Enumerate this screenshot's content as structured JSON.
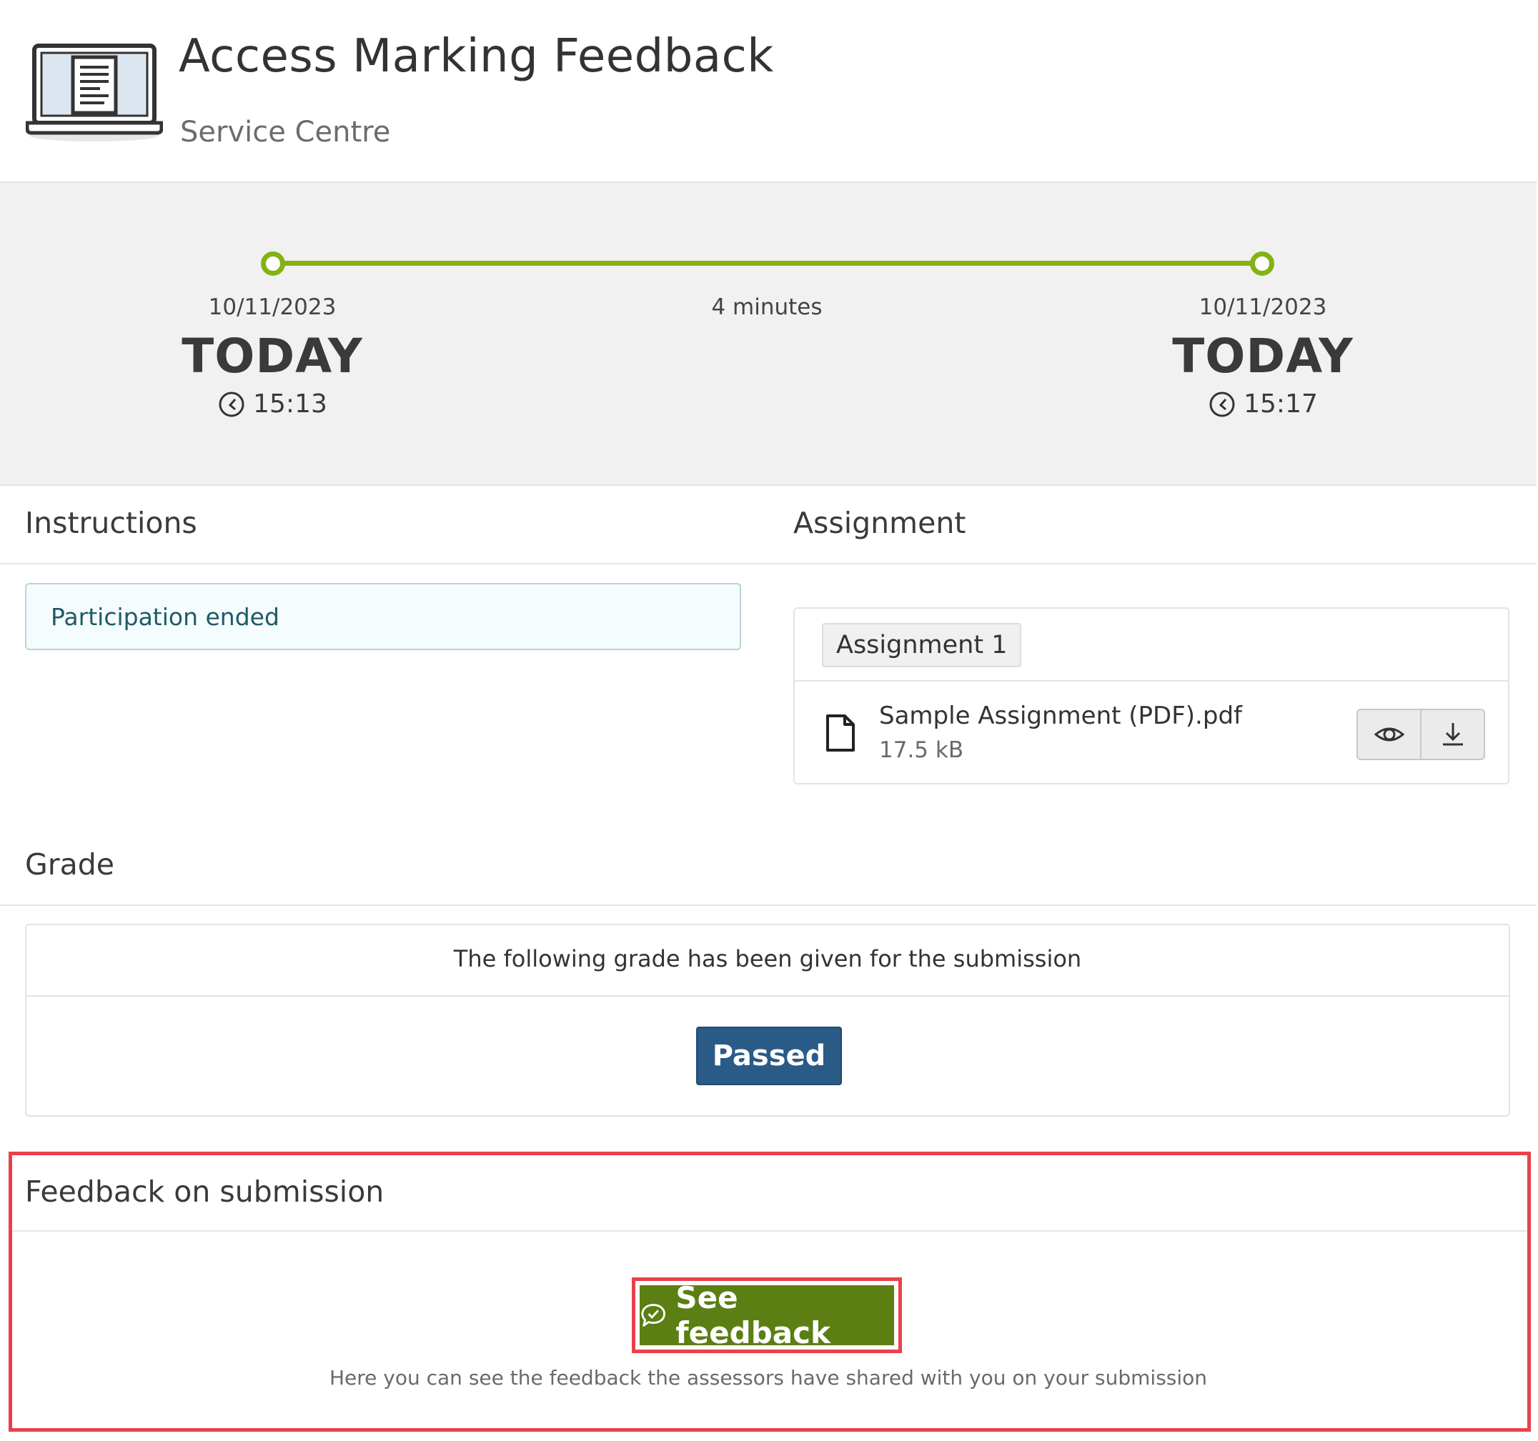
{
  "header": {
    "title": "Access Marking Feedback",
    "subtitle": "Service Centre",
    "icon": "laptop-document-icon"
  },
  "timeline": {
    "start": {
      "date": "10/11/2023",
      "day": "TODAY",
      "time": "15:13"
    },
    "end": {
      "date": "10/11/2023",
      "day": "TODAY",
      "time": "15:17"
    },
    "duration": "4 minutes",
    "accent_color": "#84b214",
    "progress": 1.0
  },
  "instructions": {
    "heading": "Instructions",
    "notice": "Participation ended"
  },
  "assignment": {
    "heading": "Assignment",
    "tab_label": "Assignment 1",
    "file": {
      "name": "Sample Assignment (PDF).pdf",
      "size": "17.5 kB",
      "icon": "file-icon"
    },
    "actions": [
      "eye-icon",
      "download-icon"
    ]
  },
  "grade": {
    "heading": "Grade",
    "text": "The following grade has been given for the submission",
    "value": "Passed",
    "badge_color": "#2a5b86"
  },
  "feedback": {
    "heading": "Feedback on submission",
    "button_label": "See feedback",
    "button_icon": "chat-check-icon",
    "button_color": "#5b7f13",
    "help_text": "Here you can see the feedback the assessors have shared with you on your submission",
    "highlight_color": "#e8414b"
  }
}
